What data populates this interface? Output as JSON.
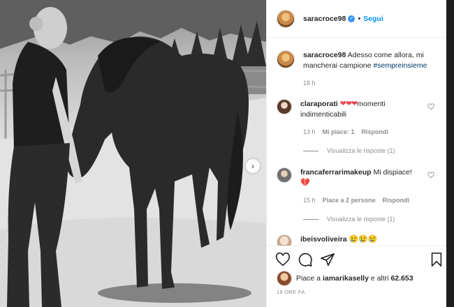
{
  "header": {
    "username": "saracroce98",
    "follow_label": "Segui",
    "separator": "•"
  },
  "caption": {
    "username": "saracroce98",
    "text": "Adesso come allora, mi mancherai campione",
    "hashtag": "#sempreinsieme",
    "time": "18 h"
  },
  "comments": [
    {
      "username": "claraporati",
      "hearts": "❤❤❤",
      "text": "momenti indimenticabili",
      "time": "13 h",
      "likes": "Mi piace: 1",
      "reply": "Rispondi",
      "view_replies": "Visualizza le risposte (1)"
    },
    {
      "username": "francaferrarimakeup",
      "text": "Mi dispiace!",
      "emoji": "💔",
      "time": "15 h",
      "likes": "Piace a 2 persone",
      "reply": "Rispondi",
      "view_replies": "Visualizza le risposte (1)"
    },
    {
      "username": "ibeisvoliveira",
      "emoji": "😢😢😢"
    }
  ],
  "likes": {
    "text_prefix": "Piace a ",
    "user": "iamarikaselly",
    "text_suffix": " e altri ",
    "count": "62.653"
  },
  "time_ago": "18 ORE FA",
  "icons": {
    "like": "heart-icon",
    "comment": "comment-icon",
    "share": "share-icon",
    "save": "bookmark-icon",
    "next": "chevron-right-icon"
  }
}
